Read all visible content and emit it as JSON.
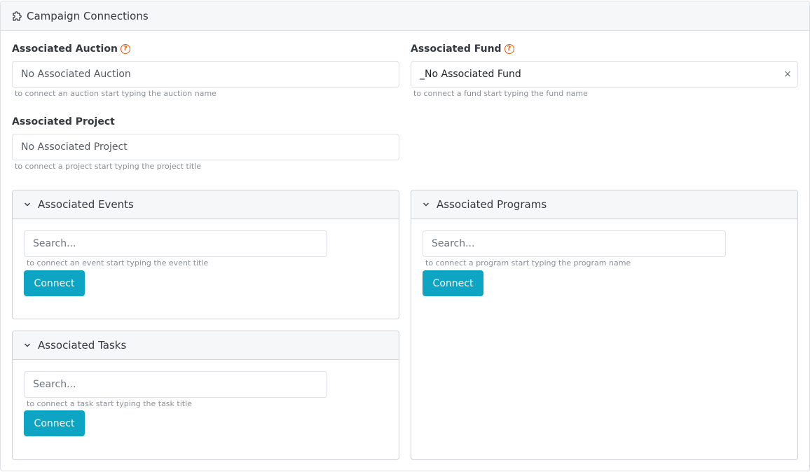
{
  "header": {
    "title": "Campaign Connections",
    "icon": "puzzle-icon"
  },
  "auction": {
    "label": "Associated Auction",
    "value": "No Associated Auction",
    "help": "to connect an auction start typing the auction name"
  },
  "fund": {
    "label": "Associated Fund",
    "value": "_No Associated Fund",
    "clear": "×",
    "help": "to connect a fund start typing the fund name"
  },
  "project": {
    "label": "Associated Project",
    "value": "No Associated Project",
    "help": "to connect a project start typing the project title"
  },
  "events": {
    "title": "Associated Events",
    "placeholder": "Search...",
    "help": "to connect an event start typing the event title",
    "button": "Connect"
  },
  "programs": {
    "title": "Associated Programs",
    "placeholder": "Search...",
    "help": "to connect a program start typing the program name",
    "button": "Connect"
  },
  "tasks": {
    "title": "Associated Tasks",
    "placeholder": "Search...",
    "help": "to connect a task start typing the task title",
    "button": "Connect"
  },
  "colors": {
    "accent": "#0ea5c4",
    "help_icon": "#e8590c"
  }
}
